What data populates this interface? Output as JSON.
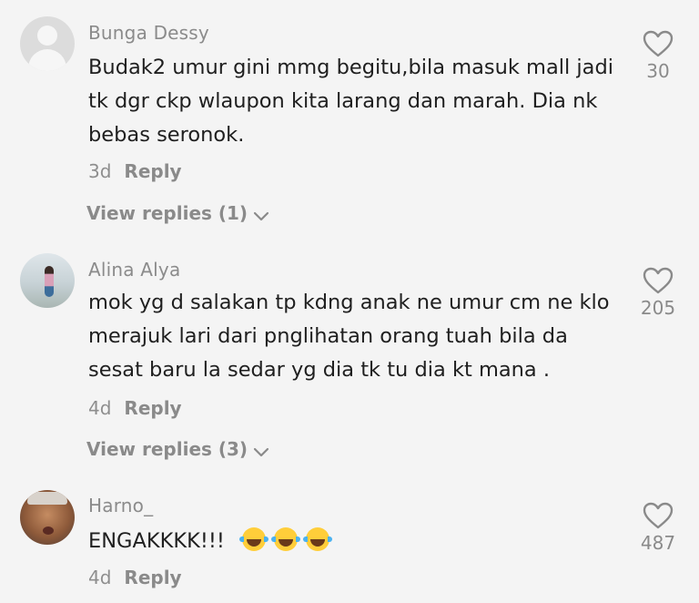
{
  "comments": [
    {
      "username": "Bunga Dessy",
      "text": "Budak2 umur gini mmg begitu,bila masuk mall jadi tk dgr ckp wlaupon kita larang dan marah. Dia nk bebas seronok.",
      "time": "3d",
      "reply_label": "Reply",
      "view_replies": "View replies (1)",
      "likes": "30",
      "avatar": "default-avatar-icon"
    },
    {
      "username": "Alina Alya",
      "text": "mok yg d salakan tp kdng anak ne umur cm ne klo merajuk lari dari pnglihatan orang tuah bila da sesat baru la sedar yg dia tk tu dia kt mana .",
      "time": "4d",
      "reply_label": "Reply",
      "view_replies": "View replies (3)",
      "likes": "205",
      "avatar": "user-photo"
    },
    {
      "username": "Harno_",
      "text": "ENGAKKKK!!!",
      "emoji": "face-with-tears-of-joy-icon x3",
      "time": "4d",
      "reply_label": "Reply",
      "likes": "487",
      "avatar": "user-photo"
    }
  ],
  "colors": {
    "background": "#f4f4f4",
    "text": "#1f1f1f",
    "muted": "#8a8a8a"
  }
}
